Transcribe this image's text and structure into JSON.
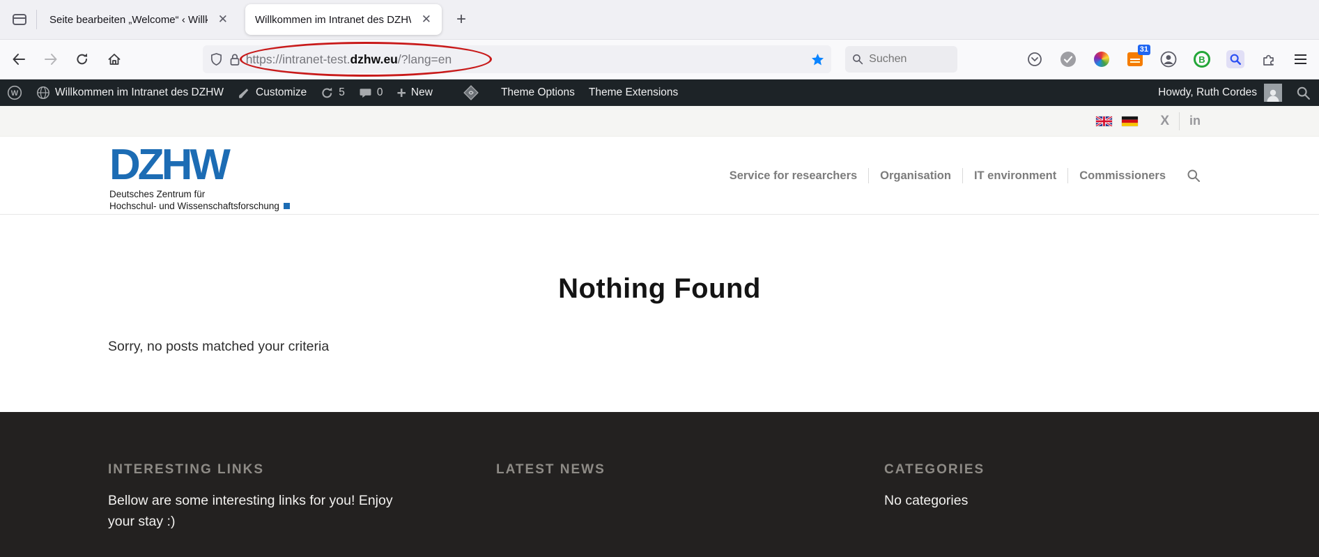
{
  "browser": {
    "tabs": [
      {
        "title": "Seite bearbeiten „Welcome“ ‹ Willk"
      },
      {
        "title": "Willkommen im Intranet des DZHW"
      }
    ],
    "url": {
      "prefix": "https://intranet-test.",
      "domain": "dzhw.eu",
      "suffix": "/?lang=en"
    },
    "search_placeholder": "Suchen",
    "extension_badge": "31",
    "extension_b_label": "B"
  },
  "admin_bar": {
    "wp_logo_letter": "W",
    "site_name": "Willkommen im Intranet des DZHW",
    "customize_label": "Customize",
    "updates_count": "5",
    "comments_count": "0",
    "new_plus": "+",
    "new_label": "New",
    "theme_options_label": "Theme Options",
    "theme_extensions_label": "Theme Extensions",
    "howdy": "Howdy, Ruth Cordes"
  },
  "utility": {
    "x_label": "X",
    "linkedin_label": "in"
  },
  "header": {
    "logo_text": "DZHW",
    "logo_sub1": "Deutsches Zentrum für",
    "logo_sub2": "Hochschul- und Wissenschaftsforschung",
    "nav": [
      {
        "label": "Service for researchers"
      },
      {
        "label": "Organisation"
      },
      {
        "label": "IT environment"
      },
      {
        "label": "Commissioners"
      }
    ]
  },
  "main": {
    "title": "Nothing Found",
    "message": "Sorry, no posts matched your criteria"
  },
  "footer": {
    "columns": [
      {
        "heading": "INTERESTING LINKS",
        "text": "Bellow are some interesting links for you! Enjoy your stay :)"
      },
      {
        "heading": "LATEST NEWS",
        "text": ""
      },
      {
        "heading": "CATEGORIES",
        "text": "No categories"
      }
    ]
  },
  "colors": {
    "accent_blue": "#1c6cb4",
    "annotation_red": "#c81a1a",
    "admin_bar_bg": "#1d2327",
    "footer_bg": "#232120",
    "bookmark_star": "#0a84ff"
  }
}
